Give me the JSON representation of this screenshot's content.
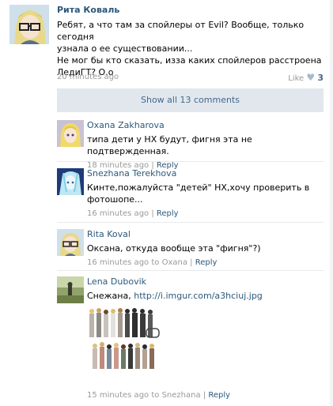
{
  "post": {
    "author": "Рита Коваль",
    "text_lines": [
      "Ребят, а что там за спойлеры от Evil? Вообще, только сегодня",
      "узнала о ее существовании...",
      "Не мог бы кто сказать, изза каких спойлеров расстроена",
      "ЛедиГТ? О.о"
    ],
    "time": "20 minutes ago",
    "like_label": "Like",
    "like_icon": "heart-icon",
    "like_count": "3"
  },
  "show_all": "Show all 13 comments",
  "comments": [
    {
      "author": "Oxana Zakharova",
      "text_lines": [
        "типа дети у НХ будут, фигня эта не подтвержденная."
      ],
      "time": "18 minutes ago",
      "sep": "|",
      "reply": "Reply"
    },
    {
      "author": "Snezhana Terekhova",
      "text_lines": [
        "Кинте,пожалуйста \"детей\" НХ,хочу проверить в",
        "фотошопе..."
      ],
      "time": "16 minutes ago",
      "sep": "|",
      "reply": "Reply"
    },
    {
      "author": "Rita Koval",
      "text_lines": [
        "Оксана, откуда вообще эта \"фигня\"?)"
      ],
      "time": "16 minutes ago",
      "to_word": "to",
      "to_name": "Oxana",
      "sep": "|",
      "reply": "Reply"
    },
    {
      "author": "Lena Dubovik",
      "text_prefix": "Снежана,",
      "link": "http://i.imgur.com/a3hciuj.jpg",
      "time": "15 minutes ago",
      "to_word": "to",
      "to_name": "Snezhana",
      "sep": "|",
      "reply": "Reply"
    }
  ],
  "colors": {
    "link": "#2b587a",
    "meta": "#999999",
    "show_all_bg": "#e1e7ed"
  }
}
